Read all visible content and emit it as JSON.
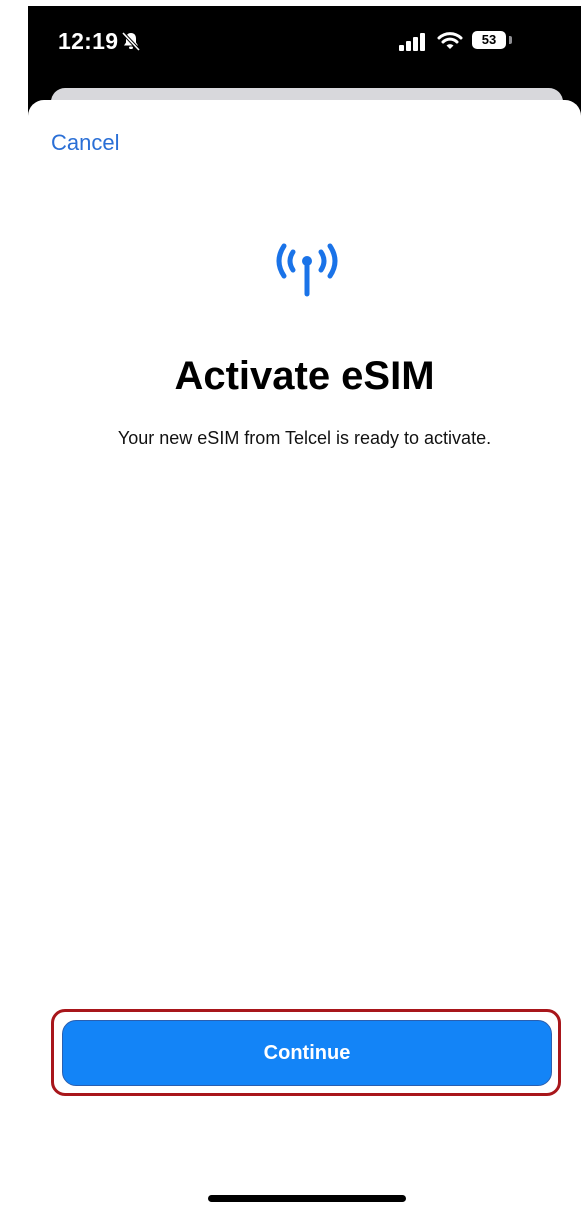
{
  "status_bar": {
    "time": "12:19",
    "battery_level": "53",
    "icons": [
      "bell-slash-icon",
      "cellular-signal-icon",
      "wifi-icon",
      "battery-icon"
    ]
  },
  "header": {
    "cancel_label": "Cancel"
  },
  "main": {
    "icon": "antenna-icon",
    "title": "Activate eSIM",
    "subtitle": "Your new eSIM from Telcel is ready to activate."
  },
  "footer": {
    "continue_label": "Continue"
  },
  "colors": {
    "accent": "#1384f7",
    "link": "#2a6fd6",
    "highlight_border": "#a8161b"
  }
}
